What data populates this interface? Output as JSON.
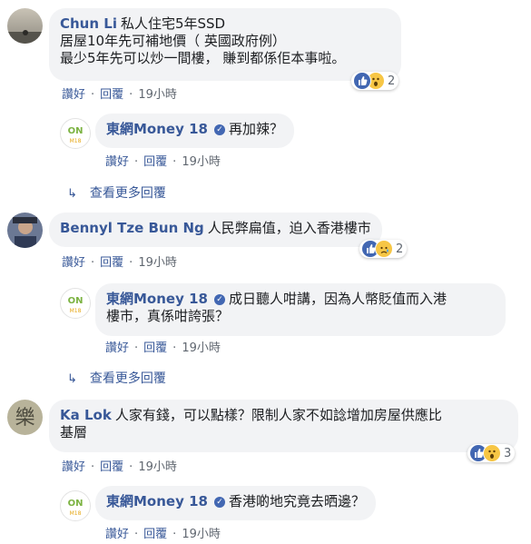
{
  "comments": [
    {
      "author": "Chun Li",
      "text_lines": [
        "私人住宅5年SSD",
        "居屋10年先可補地價（ 英國政府例）",
        "最少5年先可以炒一間樓， 賺到都係佢本事啦。"
      ],
      "actions": {
        "like": "讚好",
        "reply": "回覆",
        "time": "19小時"
      },
      "reaction_count": "2",
      "reply": {
        "author": "東網Money 18",
        "text_lines": [
          "再加辣？"
        ],
        "actions": {
          "like": "讚好",
          "reply": "回覆",
          "time": "19小時"
        }
      },
      "more_replies": "查看更多回覆"
    },
    {
      "author": "Bennyl Tze Bun Ng",
      "text_lines": [
        "人民弊扁值，迫入香港樓市"
      ],
      "actions": {
        "like": "讚好",
        "reply": "回覆",
        "time": "19小時"
      },
      "reaction_count": "2",
      "reply": {
        "author": "東網Money 18",
        "text_lines": [
          "成日聽人咁講，因為人幣貶值而入港",
          "樓市，真係咁誇張？"
        ],
        "actions": {
          "like": "讚好",
          "reply": "回覆",
          "time": "19小時"
        }
      },
      "more_replies": "查看更多回覆"
    },
    {
      "author": "Ka Lok",
      "text_lines": [
        "人家有錢，可以點樣？限制人家不如諗增加房屋供應比",
        "基層"
      ],
      "actions": {
        "like": "讚好",
        "reply": "回覆",
        "time": "19小時"
      },
      "reaction_count": "3",
      "reply": {
        "author": "東網Money 18",
        "text_lines": [
          "香港啲地究竟去晒邊？"
        ],
        "actions": {
          "like": "讚好",
          "reply": "回覆",
          "time": "19小時"
        }
      }
    }
  ],
  "colors": {
    "name": "#385898",
    "bubble": "#f2f3f5",
    "meta": "#606770",
    "like_blue": "#4267b2",
    "wow_yellow": "#f7c645"
  },
  "icons": {
    "like": "thumbs-up-icon",
    "wow": "wow-emoji-icon",
    "sad": "sad-emoji-icon",
    "verified": "verified-badge-icon",
    "reply_arrow": "reply-arrow-icon"
  }
}
